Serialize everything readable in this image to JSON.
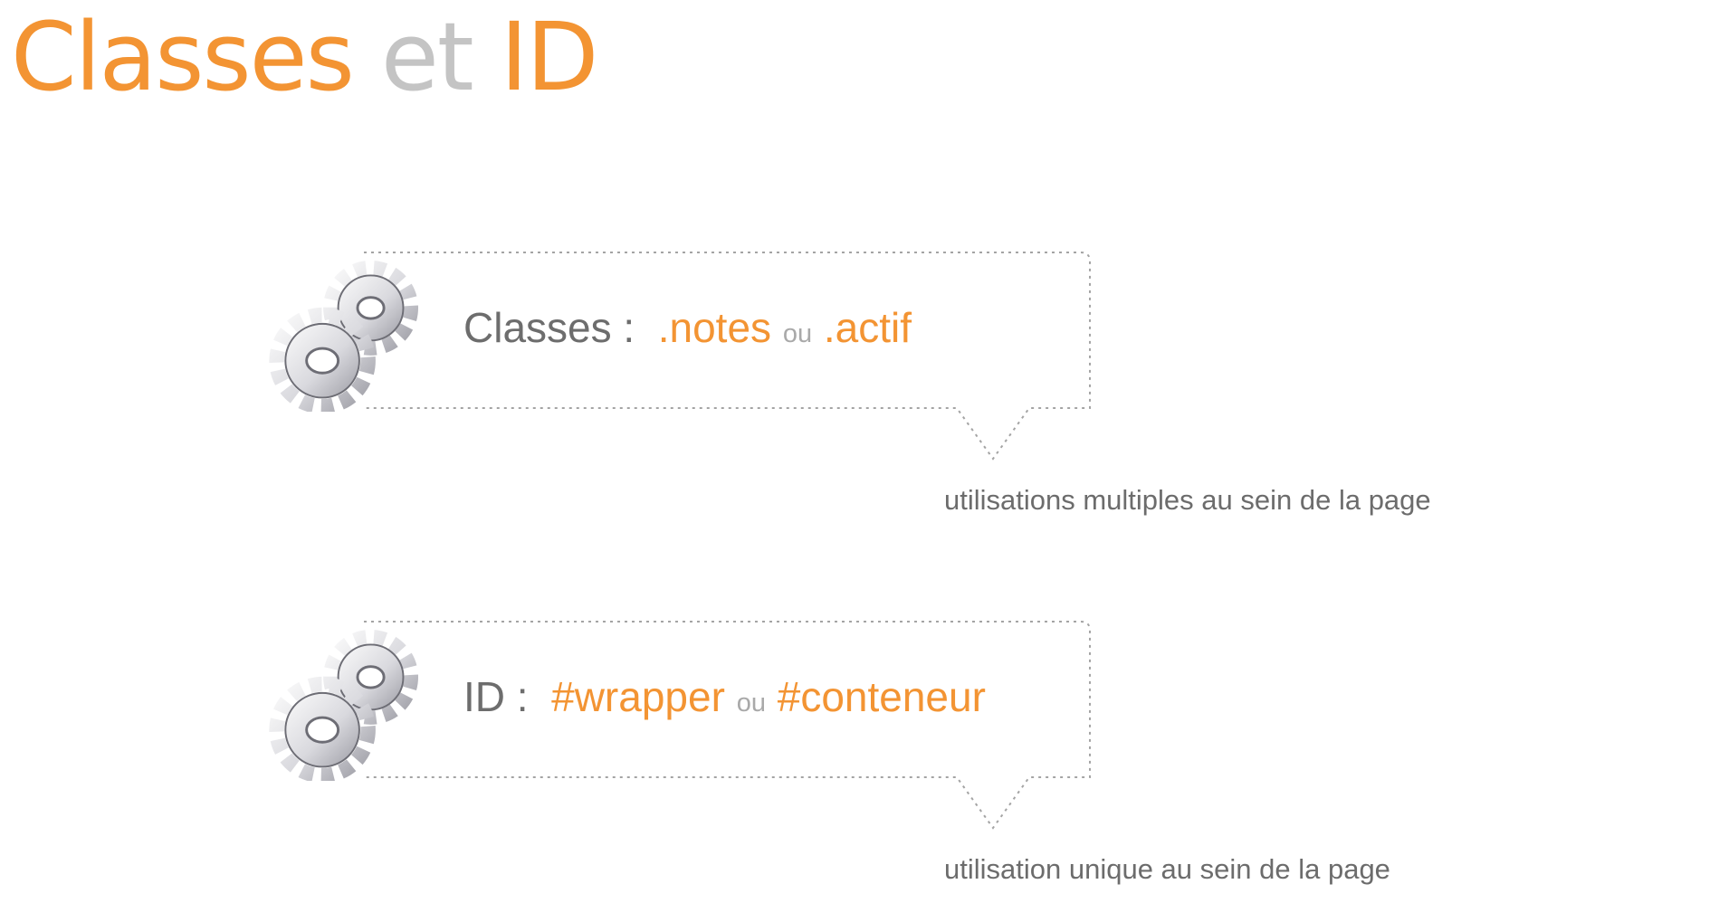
{
  "slide": {
    "title": {
      "part1": "Classes",
      "part2": "et",
      "part3": "ID"
    }
  },
  "colors": {
    "accent": "#f39433",
    "muted_title": "#c4c4c4",
    "text": "#6d6d6d"
  },
  "callouts": [
    {
      "icon": "gears-icon",
      "label": "Classes :",
      "selector_a": ".notes",
      "connector": "ou",
      "selector_b": ".actif",
      "note": "utilisations multiples au sein de la page"
    },
    {
      "icon": "gears-icon",
      "label": "ID :",
      "selector_a": "#wrapper",
      "connector": "ou",
      "selector_b": "#conteneur",
      "note": "utilisation unique au sein de la page"
    }
  ]
}
